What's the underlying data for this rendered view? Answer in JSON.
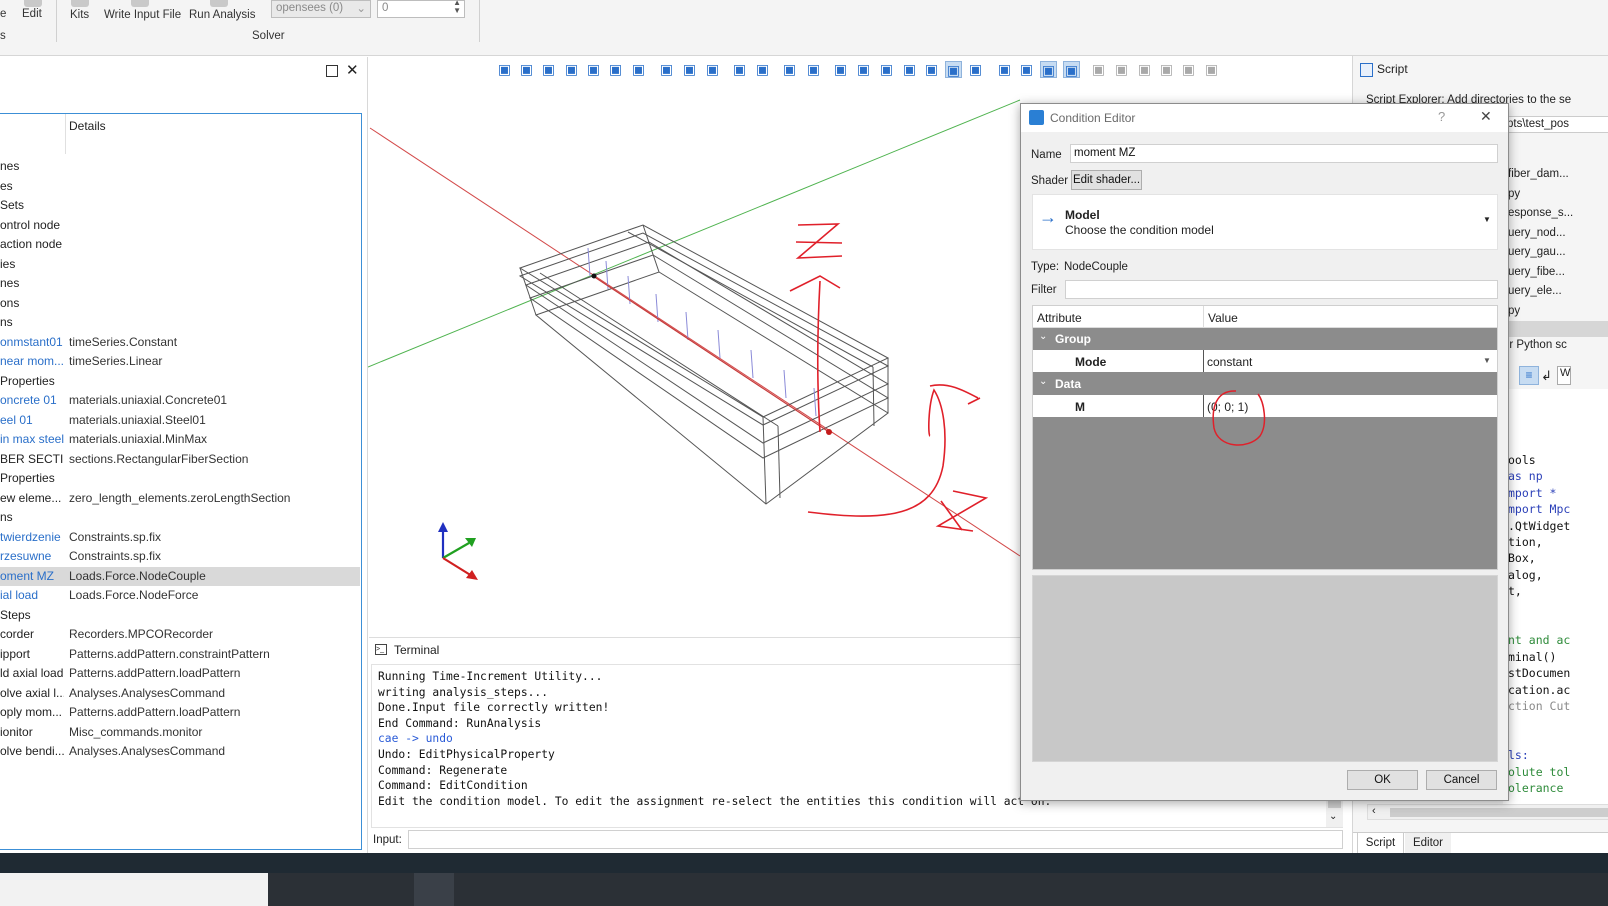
{
  "ribbon": {
    "edit_label": "Edit",
    "kits_label": "Kits",
    "write_input_label": "Write Input File",
    "run_analysis_label": "Run Analysis",
    "solver_group_label": "Solver",
    "solver_combo_value": "opensees (0)",
    "spin_value": "0",
    "left_partial_1": "e",
    "left_partial_2": "s"
  },
  "tree": {
    "details_header": "Details",
    "rows": [
      {
        "name": "nes",
        "detail": "",
        "link": false
      },
      {
        "name": "es",
        "detail": "",
        "link": false
      },
      {
        "name": "Sets",
        "detail": "",
        "link": false
      },
      {
        "name": "ontrol node",
        "detail": "",
        "link": false
      },
      {
        "name": "action node",
        "detail": "",
        "link": false
      },
      {
        "name": "ies",
        "detail": "",
        "link": false
      },
      {
        "name": "nes",
        "detail": "",
        "link": false
      },
      {
        "name": "ons",
        "detail": "",
        "link": false
      },
      {
        "name": "ns",
        "detail": "",
        "link": false
      },
      {
        "name": "onmstant01",
        "detail": "timeSeries.Constant",
        "link": true
      },
      {
        "name": "near mom...",
        "detail": "timeSeries.Linear",
        "link": true
      },
      {
        "name": "Properties",
        "detail": "",
        "link": false
      },
      {
        "name": "oncrete 01",
        "detail": "materials.uniaxial.Concrete01",
        "link": true
      },
      {
        "name": "eel 01",
        "detail": "materials.uniaxial.Steel01",
        "link": true
      },
      {
        "name": "in max steel",
        "detail": "materials.uniaxial.MinMax",
        "link": true
      },
      {
        "name": "BER SECTI...",
        "detail": "sections.RectangularFiberSection",
        "link": false
      },
      {
        "name": "Properties",
        "detail": "",
        "link": false
      },
      {
        "name": "ew eleme...",
        "detail": "zero_length_elements.zeroLengthSection",
        "link": false
      },
      {
        "name": "ns",
        "detail": "",
        "link": false
      },
      {
        "name": "twierdzenie",
        "detail": "Constraints.sp.fix",
        "link": true
      },
      {
        "name": "rzesuwne",
        "detail": "Constraints.sp.fix",
        "link": true
      },
      {
        "name": "oment MZ",
        "detail": "Loads.Force.NodeCouple",
        "link": true,
        "selected": true
      },
      {
        "name": "ial load",
        "detail": "Loads.Force.NodeForce",
        "link": true
      },
      {
        "name": "Steps",
        "detail": "",
        "link": false
      },
      {
        "name": "corder",
        "detail": "Recorders.MPCORecorder",
        "link": false
      },
      {
        "name": "ipport",
        "detail": "Patterns.addPattern.constraintPattern",
        "link": false
      },
      {
        "name": "ld axial load",
        "detail": "Patterns.addPattern.loadPattern",
        "link": false
      },
      {
        "name": "olve axial l...",
        "detail": "Analyses.AnalysesCommand",
        "link": false
      },
      {
        "name": "oply mom...",
        "detail": "Patterns.addPattern.loadPattern",
        "link": false
      },
      {
        "name": "ionitor",
        "detail": "Misc_commands.monitor",
        "link": false
      },
      {
        "name": "olve bendi...",
        "detail": "Analyses.AnalysesCommand",
        "link": false
      }
    ]
  },
  "terminal": {
    "title": "Terminal",
    "input_label": "Input:",
    "lines": [
      {
        "text": "Running Time-Increment Utility...",
        "blue": false
      },
      {
        "text": "writing analysis_steps...",
        "blue": false
      },
      {
        "text": "Done.Input file correctly written!",
        "blue": false
      },
      {
        "text": "End Command: RunAnalysis",
        "blue": false
      },
      {
        "text": "cae -> undo",
        "blue": true
      },
      {
        "text": "Undo: EditPhysicalProperty",
        "blue": false
      },
      {
        "text": "Command: Regenerate",
        "blue": false
      },
      {
        "text": "Command: EditCondition",
        "blue": false
      },
      {
        "text": "Edit the condition model. To edit the assignment re-select the entities this condition will act on.",
        "blue": false
      }
    ]
  },
  "script_panel": {
    "title": "Script",
    "explorer_text": "Script Explorer: Add directories to the se",
    "path_text": "pts\\test_pos",
    "files": [
      "fiber_dam...",
      "py",
      "esponse_s...",
      "uery_nod...",
      "uery_gau...",
      "uery_fibe...",
      "uery_ele...",
      "py"
    ],
    "python_label": "ur Python sc",
    "code_lines": [
      {
        "text": "ools",
        "color": "#111"
      },
      {
        "text": " as np",
        "color": "#2a3fb8"
      },
      {
        "text": "mport *",
        "color": "#2a3fb8"
      },
      {
        "text": "mport Mpc",
        "color": "#2a3fb8"
      },
      {
        "text": ".QtWidget",
        "color": "#111"
      },
      {
        "text": "tion,",
        "color": "#111"
      },
      {
        "text": "Box,",
        "color": "#111"
      },
      {
        "text": "alog,",
        "color": "#111"
      },
      {
        "text": "t,",
        "color": "#111"
      },
      {
        "text": "",
        "color": "#111"
      },
      {
        "text": "",
        "color": "#111"
      },
      {
        "text": "nt and ac",
        "color": "#2e8b3a"
      },
      {
        "text": "minal()",
        "color": "#111"
      },
      {
        "text": "stDocumen",
        "color": "#111"
      },
      {
        "text": "cation.ac",
        "color": "#111"
      },
      {
        "text": "ction Cut",
        "color": "#8a8a8a"
      },
      {
        "text": "",
        "color": "#111"
      },
      {
        "text": "",
        "color": "#111"
      },
      {
        "text": "ls:",
        "color": "#2a3fb8"
      },
      {
        "text": "olute tol",
        "color": "#2e8b3a"
      },
      {
        "text": "olerance",
        "color": "#2e8b3a"
      }
    ],
    "tab_script": "Script",
    "tab_editor": "Editor"
  },
  "dialog": {
    "title": "Condition Editor",
    "help_glyph": "?",
    "close_glyph": "✕",
    "name_label": "Name",
    "name_value": "moment MZ",
    "shader_label": "Shader",
    "shader_button": "Edit shader...",
    "model_title": "Model",
    "model_subtitle": "Choose the condition model",
    "type_label": "Type:",
    "type_value": "NodeCouple",
    "filter_label": "Filter",
    "filter_value": "",
    "col_attribute": "Attribute",
    "col_value": "Value",
    "group_label": "Group",
    "mode_label": "Mode",
    "mode_value": "constant",
    "data_label": "Data",
    "m_label": "M",
    "m_value": "(0; 0; 1)",
    "ok_label": "OK",
    "cancel_label": "Cancel"
  },
  "colors": {
    "accent": "#2a6fc9",
    "selection": "#d9d9d9",
    "annotation": "#e0202a",
    "axis_red": "#d03030",
    "axis_green": "#2ea02e",
    "group_header": "#8c8c8c"
  },
  "icons": [
    "undock-icon",
    "close-icon",
    "cube-view-icon",
    "zoom-icon",
    "terminal-icon",
    "script-icon",
    "arrow-right-icon",
    "chevron-down-icon"
  ]
}
